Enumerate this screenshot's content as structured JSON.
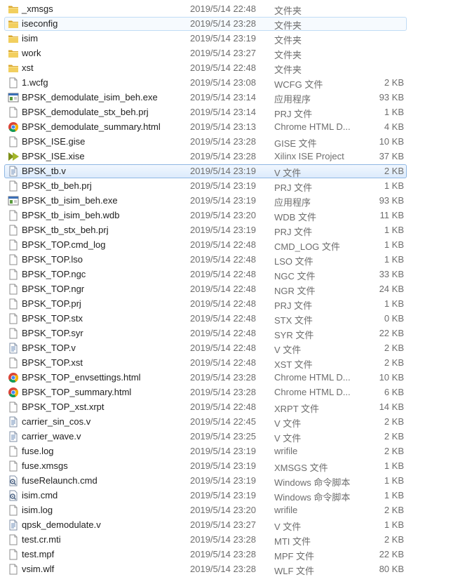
{
  "files": [
    {
      "name": "_xmsgs",
      "date": "2019/5/14 22:48",
      "type": "文件夹",
      "size": "",
      "icon": "folder-icon"
    },
    {
      "name": "iseconfig",
      "date": "2019/5/14 23:28",
      "type": "文件夹",
      "size": "",
      "icon": "folder-icon",
      "state": "hover"
    },
    {
      "name": "isim",
      "date": "2019/5/14 23:19",
      "type": "文件夹",
      "size": "",
      "icon": "folder-icon"
    },
    {
      "name": "work",
      "date": "2019/5/14 23:27",
      "type": "文件夹",
      "size": "",
      "icon": "folder-icon"
    },
    {
      "name": "xst",
      "date": "2019/5/14 22:48",
      "type": "文件夹",
      "size": "",
      "icon": "folder-icon"
    },
    {
      "name": "1.wcfg",
      "date": "2019/5/14 23:08",
      "type": "WCFG 文件",
      "size": "2 KB",
      "icon": "file-icon"
    },
    {
      "name": "BPSK_demodulate_isim_beh.exe",
      "date": "2019/5/14 23:14",
      "type": "应用程序",
      "size": "93 KB",
      "icon": "exe-icon"
    },
    {
      "name": "BPSK_demodulate_stx_beh.prj",
      "date": "2019/5/14 23:14",
      "type": "PRJ 文件",
      "size": "1 KB",
      "icon": "file-icon"
    },
    {
      "name": "BPSK_demodulate_summary.html",
      "date": "2019/5/14 23:13",
      "type": "Chrome HTML D...",
      "size": "4 KB",
      "icon": "chrome-icon"
    },
    {
      "name": "BPSK_ISE.gise",
      "date": "2019/5/14 23:28",
      "type": "GISE 文件",
      "size": "10 KB",
      "icon": "file-icon"
    },
    {
      "name": "BPSK_ISE.xise",
      "date": "2019/5/14 23:28",
      "type": "Xilinx ISE Project",
      "size": "37 KB",
      "icon": "xilinx-icon"
    },
    {
      "name": "BPSK_tb.v",
      "date": "2019/5/14 23:19",
      "type": "V 文件",
      "size": "2 KB",
      "icon": "text-file-icon",
      "state": "selected"
    },
    {
      "name": "BPSK_tb_beh.prj",
      "date": "2019/5/14 23:19",
      "type": "PRJ 文件",
      "size": "1 KB",
      "icon": "file-icon"
    },
    {
      "name": "BPSK_tb_isim_beh.exe",
      "date": "2019/5/14 23:19",
      "type": "应用程序",
      "size": "93 KB",
      "icon": "exe-icon"
    },
    {
      "name": "BPSK_tb_isim_beh.wdb",
      "date": "2019/5/14 23:20",
      "type": "WDB 文件",
      "size": "11 KB",
      "icon": "file-icon"
    },
    {
      "name": "BPSK_tb_stx_beh.prj",
      "date": "2019/5/14 23:19",
      "type": "PRJ 文件",
      "size": "1 KB",
      "icon": "file-icon"
    },
    {
      "name": "BPSK_TOP.cmd_log",
      "date": "2019/5/14 22:48",
      "type": "CMD_LOG 文件",
      "size": "1 KB",
      "icon": "file-icon"
    },
    {
      "name": "BPSK_TOP.lso",
      "date": "2019/5/14 22:48",
      "type": "LSO 文件",
      "size": "1 KB",
      "icon": "file-icon"
    },
    {
      "name": "BPSK_TOP.ngc",
      "date": "2019/5/14 22:48",
      "type": "NGC 文件",
      "size": "33 KB",
      "icon": "file-icon"
    },
    {
      "name": "BPSK_TOP.ngr",
      "date": "2019/5/14 22:48",
      "type": "NGR 文件",
      "size": "24 KB",
      "icon": "file-icon"
    },
    {
      "name": "BPSK_TOP.prj",
      "date": "2019/5/14 22:48",
      "type": "PRJ 文件",
      "size": "1 KB",
      "icon": "file-icon"
    },
    {
      "name": "BPSK_TOP.stx",
      "date": "2019/5/14 22:48",
      "type": "STX 文件",
      "size": "0 KB",
      "icon": "file-icon"
    },
    {
      "name": "BPSK_TOP.syr",
      "date": "2019/5/14 22:48",
      "type": "SYR 文件",
      "size": "22 KB",
      "icon": "file-icon"
    },
    {
      "name": "BPSK_TOP.v",
      "date": "2019/5/14 22:48",
      "type": "V 文件",
      "size": "2 KB",
      "icon": "text-file-icon"
    },
    {
      "name": "BPSK_TOP.xst",
      "date": "2019/5/14 22:48",
      "type": "XST 文件",
      "size": "2 KB",
      "icon": "file-icon"
    },
    {
      "name": "BPSK_TOP_envsettings.html",
      "date": "2019/5/14 23:28",
      "type": "Chrome HTML D...",
      "size": "10 KB",
      "icon": "chrome-icon"
    },
    {
      "name": "BPSK_TOP_summary.html",
      "date": "2019/5/14 23:28",
      "type": "Chrome HTML D...",
      "size": "6 KB",
      "icon": "chrome-icon"
    },
    {
      "name": "BPSK_TOP_xst.xrpt",
      "date": "2019/5/14 22:48",
      "type": "XRPT 文件",
      "size": "14 KB",
      "icon": "file-icon"
    },
    {
      "name": "carrier_sin_cos.v",
      "date": "2019/5/14 22:45",
      "type": "V 文件",
      "size": "2 KB",
      "icon": "text-file-icon"
    },
    {
      "name": "carrier_wave.v",
      "date": "2019/5/14 23:25",
      "type": "V 文件",
      "size": "2 KB",
      "icon": "text-file-icon"
    },
    {
      "name": "fuse.log",
      "date": "2019/5/14 23:19",
      "type": "wrifile",
      "size": "2 KB",
      "icon": "file-icon"
    },
    {
      "name": "fuse.xmsgs",
      "date": "2019/5/14 23:19",
      "type": "XMSGS 文件",
      "size": "1 KB",
      "icon": "file-icon"
    },
    {
      "name": "fuseRelaunch.cmd",
      "date": "2019/5/14 23:19",
      "type": "Windows 命令脚本",
      "size": "1 KB",
      "icon": "cmd-icon"
    },
    {
      "name": "isim.cmd",
      "date": "2019/5/14 23:19",
      "type": "Windows 命令脚本",
      "size": "1 KB",
      "icon": "cmd-icon"
    },
    {
      "name": "isim.log",
      "date": "2019/5/14 23:20",
      "type": "wrifile",
      "size": "2 KB",
      "icon": "file-icon"
    },
    {
      "name": "qpsk_demodulate.v",
      "date": "2019/5/14 23:27",
      "type": "V 文件",
      "size": "1 KB",
      "icon": "text-file-icon"
    },
    {
      "name": "test.cr.mti",
      "date": "2019/5/14 23:28",
      "type": "MTI 文件",
      "size": "2 KB",
      "icon": "file-icon"
    },
    {
      "name": "test.mpf",
      "date": "2019/5/14 23:28",
      "type": "MPF 文件",
      "size": "22 KB",
      "icon": "file-icon"
    },
    {
      "name": "vsim.wlf",
      "date": "2019/5/14 23:28",
      "type": "WLF 文件",
      "size": "80 KB",
      "icon": "file-icon"
    }
  ],
  "colors": {
    "selection_border": "#8fb7e3",
    "hover_border": "#c1dcf5",
    "folder": "#e8c25a",
    "chrome_red": "#db4437",
    "chrome_green": "#0f9d58",
    "chrome_yellow": "#f4b400",
    "chrome_blue": "#4285f4",
    "xilinx": "#8a9a1e"
  }
}
